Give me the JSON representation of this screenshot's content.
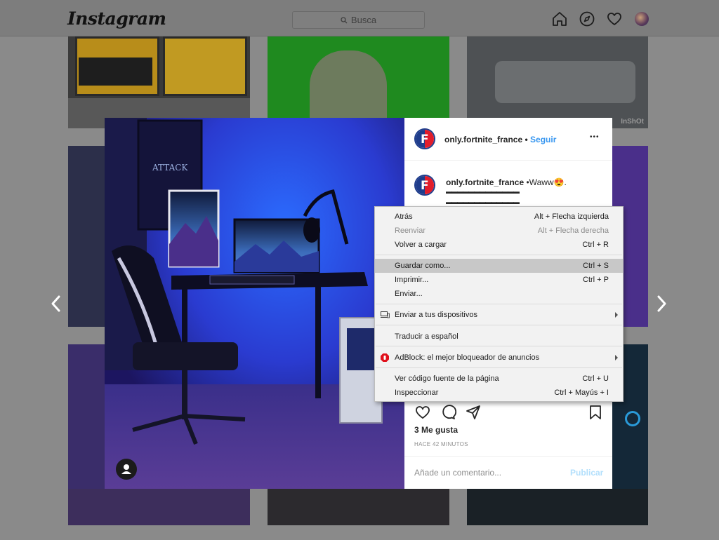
{
  "header": {
    "logo": "Instagram",
    "search_placeholder": "Busca"
  },
  "icons": {
    "home": "home-icon",
    "explore": "compass-icon",
    "activity": "heart-icon",
    "profile": "avatar"
  },
  "tiles": {
    "watermark": "InShOt"
  },
  "post": {
    "username": "only.fortnite_france",
    "separator": "•",
    "follow_label": "Seguir",
    "more_label": "•••",
    "caption_user": "only.fortnite_france",
    "caption_text": "•Waww😍.",
    "caption_line1": "▬▬▬▬▬▬▬▬▬▬▬▬▬",
    "caption_line2": "▬▬▬▬▬▬▬▬▬▬▬▬▬",
    "likes": "3 Me gusta",
    "time": "HACE 42 MINUTOS",
    "comment_placeholder": "Añade un comentario...",
    "publish_label": "Publicar"
  },
  "context_menu": {
    "items": [
      {
        "label": "Atrás",
        "shortcut": "Alt + Flecha izquierda"
      },
      {
        "label": "Reenviar",
        "shortcut": "Alt + Flecha derecha"
      },
      {
        "label": "Volver a cargar",
        "shortcut": "Ctrl + R"
      },
      {
        "label": "Guardar como...",
        "shortcut": "Ctrl + S"
      },
      {
        "label": "Imprimir...",
        "shortcut": "Ctrl + P"
      },
      {
        "label": "Enviar...",
        "shortcut": ""
      },
      {
        "label": "Enviar a tus dispositivos",
        "shortcut": ""
      },
      {
        "label": "Traducir a español",
        "shortcut": ""
      },
      {
        "label": "AdBlock: el mejor bloqueador de anuncios",
        "shortcut": ""
      },
      {
        "label": "Ver código fuente de la página",
        "shortcut": "Ctrl + U"
      },
      {
        "label": "Inspeccionar",
        "shortcut": "Ctrl + Mayús + I"
      }
    ]
  },
  "colors": {
    "accent": "#3897f0",
    "menu_highlight": "#c8c8c8",
    "adblock": "#e0101b"
  }
}
